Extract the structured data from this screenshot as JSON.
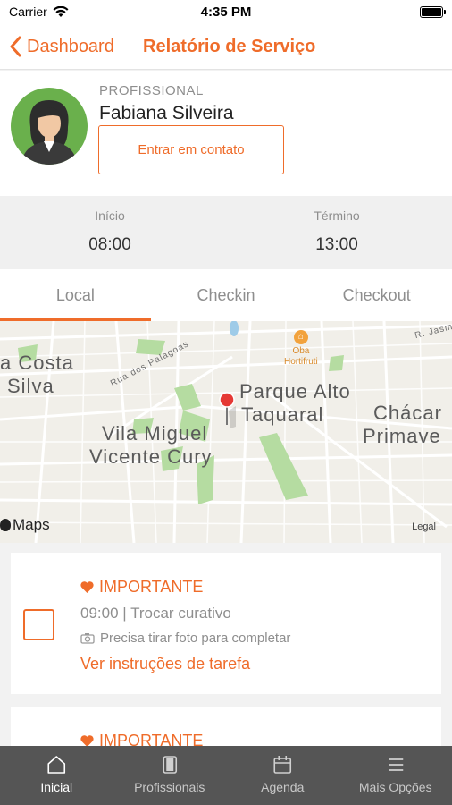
{
  "status_bar": {
    "carrier": "Carrier",
    "time": "4:35 PM"
  },
  "nav": {
    "back_label": "Dashboard",
    "title": "Relatório de Serviço"
  },
  "profile": {
    "role": "PROFISSIONAL",
    "name": "Fabiana Silveira",
    "contact_label": "Entrar em contato"
  },
  "schedule": {
    "start": {
      "label": "Início",
      "value": "08:00"
    },
    "end": {
      "label": "Término",
      "value": "13:00"
    }
  },
  "tabs": [
    {
      "label": "Local",
      "active": true
    },
    {
      "label": "Checkin",
      "active": false
    },
    {
      "label": "Checkout",
      "active": false
    }
  ],
  "map": {
    "labels": {
      "costa_silva_1": "a Costa",
      "costa_silva_2": "Silva",
      "rua_palagoas": "Rua dos Palagoas",
      "parque_1": "Parque Alto",
      "parque_2": "Taquaral",
      "vila_1": "Vila Miguel",
      "vila_2": "Vicente Cury",
      "chacara_1": "Chácar",
      "chacara_2": "Primave",
      "poi_1": "Oba",
      "poi_2": "Hortifruti",
      "street_jasm": "R. Jasm"
    },
    "maps_brand": "Maps",
    "legal": "Legal"
  },
  "tasks": [
    {
      "importance": "IMPORTANTE",
      "time": "09:00",
      "separator": " | ",
      "title": "Trocar curativo",
      "photo_note": "Precisa tirar foto para completar",
      "link": "Ver instruções de tarefa"
    },
    {
      "importance": "IMPORTANTE"
    }
  ],
  "tab_bar": [
    {
      "label": "Inicial",
      "icon": "home-icon",
      "active": true
    },
    {
      "label": "Profissionais",
      "icon": "professionals-icon",
      "active": false
    },
    {
      "label": "Agenda",
      "icon": "calendar-icon",
      "active": false
    },
    {
      "label": "Mais Opções",
      "icon": "menu-icon",
      "active": false
    }
  ],
  "colors": {
    "accent": "#ef6c2a",
    "tab_bar_bg": "#555555"
  }
}
